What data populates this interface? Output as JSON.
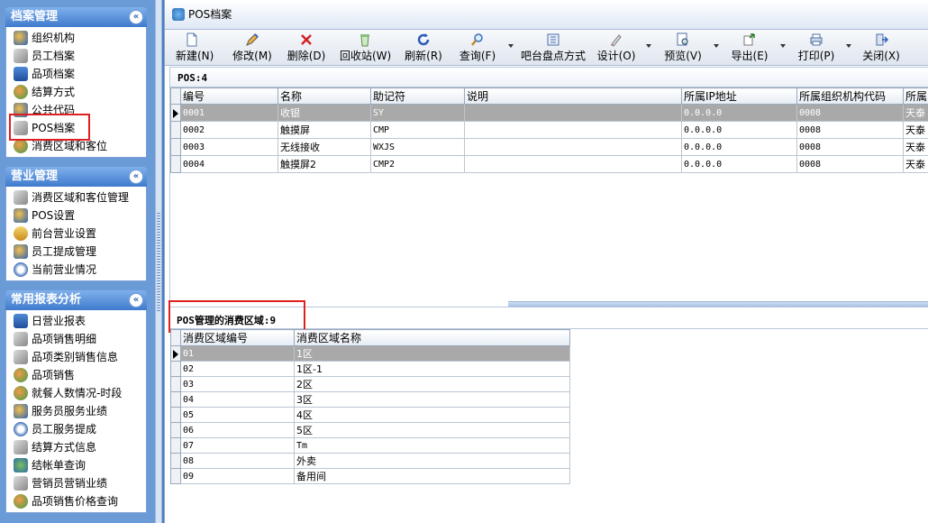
{
  "nav": {
    "sections": [
      {
        "title": "档案管理",
        "collapse_glyph": "«",
        "items": [
          {
            "label": "组织机构",
            "icon": "org-icon"
          },
          {
            "label": "员工档案",
            "icon": "staff-icon"
          },
          {
            "label": "品项档案",
            "icon": "item-icon"
          },
          {
            "label": "结算方式",
            "icon": "settlement-icon"
          },
          {
            "label": "公共代码",
            "icon": "code-icon"
          },
          {
            "label": "POS档案",
            "icon": "pos-icon"
          },
          {
            "label": "消费区域和客位",
            "icon": "area-icon"
          }
        ]
      },
      {
        "title": "营业管理",
        "collapse_glyph": "«",
        "items": [
          {
            "label": "消费区域和客位管理",
            "icon": "area-manage-icon"
          },
          {
            "label": "POS设置",
            "icon": "pos-settings-icon"
          },
          {
            "label": "前台营业设置",
            "icon": "frontdesk-icon"
          },
          {
            "label": "员工提成管理",
            "icon": "commission-icon"
          },
          {
            "label": "当前营业情况",
            "icon": "status-icon"
          }
        ]
      },
      {
        "title": "常用报表分析",
        "collapse_glyph": "«",
        "items": [
          {
            "label": "日营业报表",
            "icon": "report-icon"
          },
          {
            "label": "品项销售明细",
            "icon": "sales-detail-icon"
          },
          {
            "label": "品项类别销售信息",
            "icon": "category-icon"
          },
          {
            "label": "品项销售",
            "icon": "item-sales-icon"
          },
          {
            "label": "就餐人数情况-时段",
            "icon": "diners-icon"
          },
          {
            "label": "服务员服务业绩",
            "icon": "waiter-icon"
          },
          {
            "label": "员工服务提成",
            "icon": "staff-commission-icon"
          },
          {
            "label": "结算方式信息",
            "icon": "settlement-info-icon"
          },
          {
            "label": "结帐单查询",
            "icon": "bill-query-icon"
          },
          {
            "label": "营销员营销业绩",
            "icon": "marketer-icon"
          },
          {
            "label": "品项销售价格查询",
            "icon": "price-query-icon"
          }
        ]
      }
    ]
  },
  "window": {
    "title": "POS档案"
  },
  "toolbar": {
    "new": "新建(N)",
    "edit": "修改(M)",
    "delete": "删除(D)",
    "recycle": "回收站(W)",
    "refresh": "刷新(R)",
    "query": "查询(F)",
    "bar_count": "吧台盘点方式",
    "design": "设计(O)",
    "preview": "预览(V)",
    "export": "导出(E)",
    "print": "打印(P)",
    "close": "关闭(X)"
  },
  "pos_grid": {
    "label": "POS:4",
    "columns": [
      "编号",
      "名称",
      "助记符",
      "说明",
      "所属IP地址",
      "所属组织机构代码",
      "所属"
    ],
    "rows": [
      {
        "id": "0001",
        "name": "收银",
        "code": "SY",
        "desc": "",
        "ip": "0.0.0.0",
        "org": "0008",
        "belong": "天泰"
      },
      {
        "id": "0002",
        "name": "触摸屏",
        "code": "CMP",
        "desc": "",
        "ip": "0.0.0.0",
        "org": "0008",
        "belong": "天泰"
      },
      {
        "id": "0003",
        "name": "无线接收",
        "code": "WXJS",
        "desc": "",
        "ip": "0.0.0.0",
        "org": "0008",
        "belong": "天泰"
      },
      {
        "id": "0004",
        "name": "触摸屏2",
        "code": "CMP2",
        "desc": "",
        "ip": "0.0.0.0",
        "org": "0008",
        "belong": "天泰"
      }
    ]
  },
  "area_grid": {
    "label": "POS管理的消费区域:9",
    "columns": [
      "消费区域编号",
      "消费区域名称"
    ],
    "rows": [
      {
        "id": "01",
        "name": "1区"
      },
      {
        "id": "02",
        "name": "1区-1"
      },
      {
        "id": "03",
        "name": "2区"
      },
      {
        "id": "04",
        "name": "3区"
      },
      {
        "id": "05",
        "name": "4区"
      },
      {
        "id": "06",
        "name": "5区"
      },
      {
        "id": "07",
        "name": "Tm"
      },
      {
        "id": "08",
        "name": "外卖"
      },
      {
        "id": "09",
        "name": "备用间"
      }
    ]
  },
  "colors": {
    "selected_row": "#a9a9a9",
    "highlight_box": "#e02020",
    "nav_header": "#3f7acd"
  }
}
